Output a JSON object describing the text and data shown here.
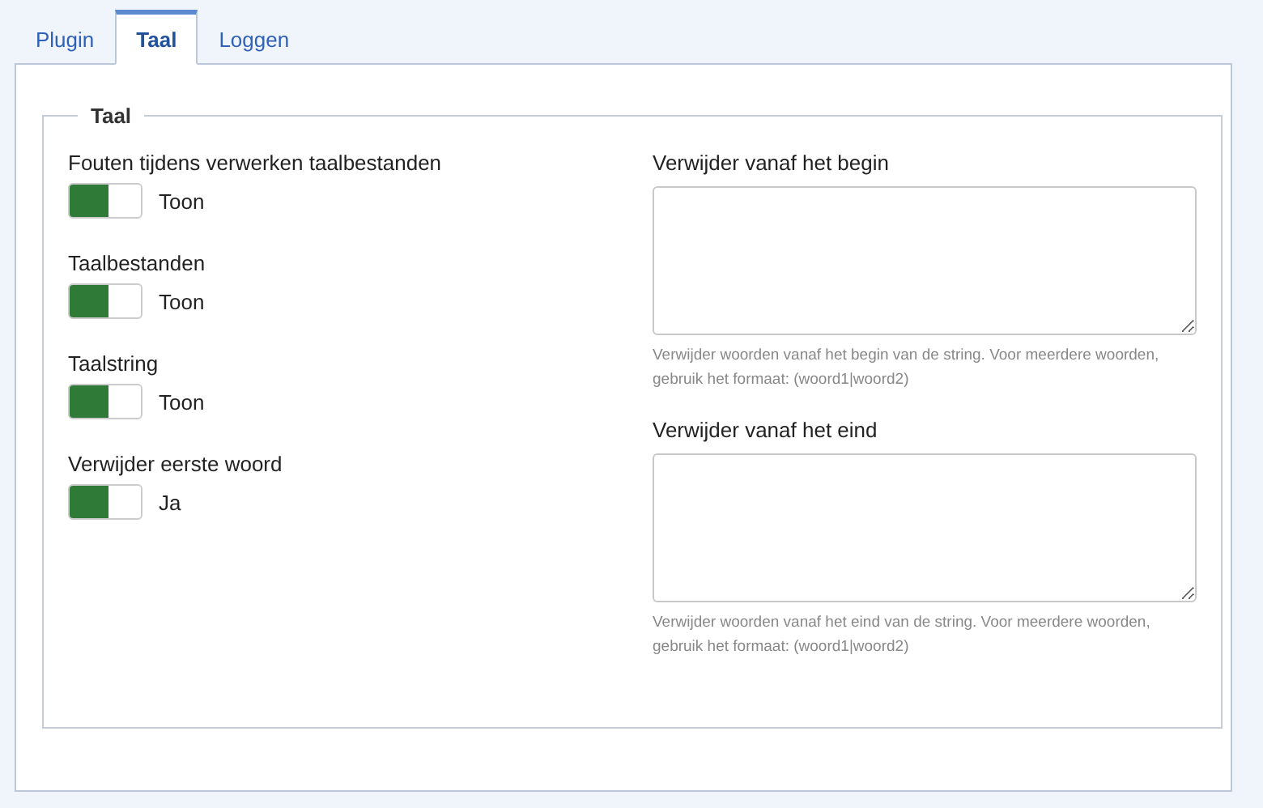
{
  "tabs": [
    {
      "label": "Plugin",
      "selected": false
    },
    {
      "label": "Taal",
      "selected": true
    },
    {
      "label": "Loggen",
      "selected": false
    }
  ],
  "fieldset": {
    "legend": "Taal",
    "switches": [
      {
        "label": "Fouten tijdens verwerken taalbestanden",
        "on": true,
        "value": "Toon"
      },
      {
        "label": "Taalbestanden",
        "on": true,
        "value": "Toon"
      },
      {
        "label": "Taalstring",
        "on": true,
        "value": "Toon"
      },
      {
        "label": "Verwijder eerste woord",
        "on": true,
        "value": "Ja"
      }
    ],
    "textareas": [
      {
        "label": "Verwijder vanaf het begin",
        "help": "Verwijder woorden vanaf het begin van de string. Voor meerdere woorden, gebruik het formaat: (woord1|woord2)"
      },
      {
        "label": "Verwijder vanaf het eind",
        "help": "Verwijder woorden vanaf het eind van de string. Voor meerdere woorden, gebruik het formaat: (woord1|woord2)"
      }
    ]
  }
}
